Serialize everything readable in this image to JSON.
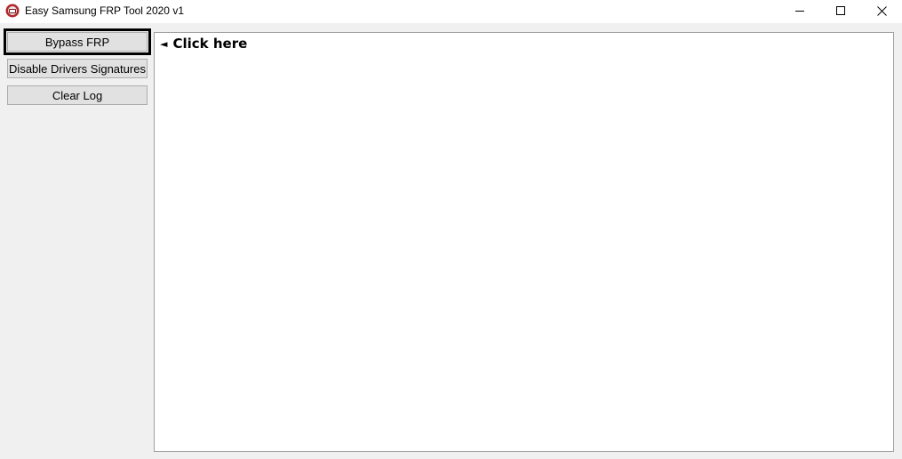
{
  "window": {
    "title": "Easy Samsung FRP Tool 2020 v1",
    "icon": "samsung-frp-app-icon"
  },
  "controls": {
    "minimize_icon": "minimize-icon",
    "maximize_icon": "maximize-icon",
    "close_icon": "close-icon"
  },
  "sidebar": {
    "buttons": [
      {
        "label": "Bypass FRP",
        "focused": true
      },
      {
        "label": "Disable Drivers Signatures",
        "focused": false
      },
      {
        "label": "Clear Log",
        "focused": false
      }
    ]
  },
  "log": {
    "arrow": "◄",
    "message": "Click here"
  },
  "colors": {
    "window_bg": "#f0f0f0",
    "button_bg": "#e1e1e1",
    "button_border": "#adadad",
    "focus_outline": "#000000",
    "log_bg": "#ffffff"
  }
}
